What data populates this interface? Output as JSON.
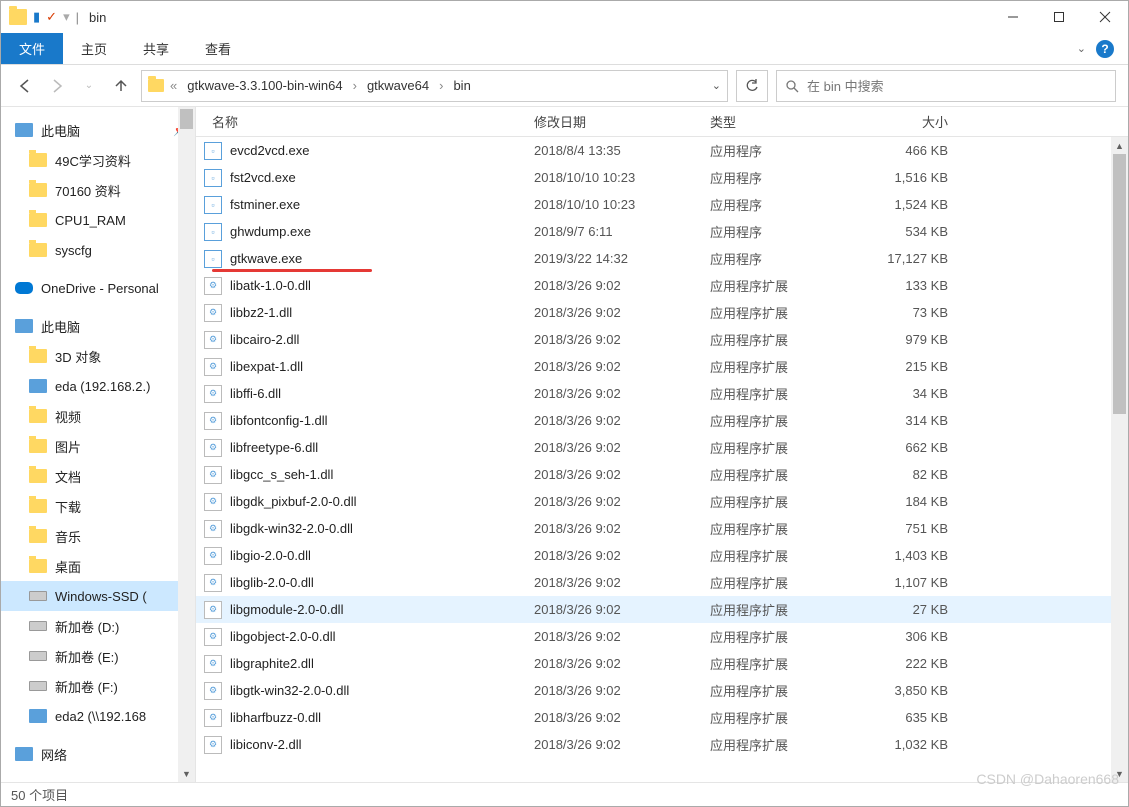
{
  "window": {
    "title": "bin",
    "separator": "|"
  },
  "ribbon": {
    "file": "文件",
    "tabs": [
      "主页",
      "共享",
      "查看"
    ]
  },
  "nav": {
    "back": "←",
    "forward": "→",
    "up": "↑"
  },
  "breadcrumbs": [
    "gtkwave-3.3.100-bin-win64",
    "gtkwave64",
    "bin"
  ],
  "search": {
    "placeholder": "在 bin 中搜索"
  },
  "navpane": {
    "quick": [
      {
        "label": "此电脑",
        "icon": "computer",
        "pin": true
      },
      {
        "label": "49C学习资料",
        "icon": "folder"
      },
      {
        "label": "70160 资料",
        "icon": "folder"
      },
      {
        "label": "CPU1_RAM",
        "icon": "folder"
      },
      {
        "label": "syscfg",
        "icon": "folder"
      }
    ],
    "onedrive": {
      "label": "OneDrive - Personal",
      "icon": "cloud"
    },
    "thispc": {
      "label": "此电脑",
      "icon": "computer"
    },
    "thispc_items": [
      {
        "label": "3D 对象",
        "icon": "folder"
      },
      {
        "label": "eda (192.168.2.)",
        "icon": "net"
      },
      {
        "label": "视频",
        "icon": "folder"
      },
      {
        "label": "图片",
        "icon": "folder"
      },
      {
        "label": "文档",
        "icon": "folder"
      },
      {
        "label": "下载",
        "icon": "folder"
      },
      {
        "label": "音乐",
        "icon": "folder"
      },
      {
        "label": "桌面",
        "icon": "folder"
      },
      {
        "label": "Windows-SSD (",
        "icon": "disk",
        "selected": true
      },
      {
        "label": "新加卷 (D:)",
        "icon": "disk"
      },
      {
        "label": "新加卷 (E:)",
        "icon": "disk"
      },
      {
        "label": "新加卷 (F:)",
        "icon": "disk"
      },
      {
        "label": "eda2 (\\\\192.168",
        "icon": "net"
      }
    ],
    "network": {
      "label": "网络",
      "icon": "net"
    }
  },
  "columns": {
    "name": "名称",
    "date": "修改日期",
    "type": "类型",
    "size": "大小"
  },
  "files": [
    {
      "name": "evcd2vcd.exe",
      "date": "2018/8/4 13:35",
      "type": "应用程序",
      "size": "466 KB",
      "icon": "exe"
    },
    {
      "name": "fst2vcd.exe",
      "date": "2018/10/10 10:23",
      "type": "应用程序",
      "size": "1,516 KB",
      "icon": "exe"
    },
    {
      "name": "fstminer.exe",
      "date": "2018/10/10 10:23",
      "type": "应用程序",
      "size": "1,524 KB",
      "icon": "exe"
    },
    {
      "name": "ghwdump.exe",
      "date": "2018/9/7 6:11",
      "type": "应用程序",
      "size": "534 KB",
      "icon": "exe"
    },
    {
      "name": "gtkwave.exe",
      "date": "2019/3/22 14:32",
      "type": "应用程序",
      "size": "17,127 KB",
      "icon": "exe",
      "underline": true
    },
    {
      "name": "libatk-1.0-0.dll",
      "date": "2018/3/26 9:02",
      "type": "应用程序扩展",
      "size": "133 KB",
      "icon": "dll"
    },
    {
      "name": "libbz2-1.dll",
      "date": "2018/3/26 9:02",
      "type": "应用程序扩展",
      "size": "73 KB",
      "icon": "dll"
    },
    {
      "name": "libcairo-2.dll",
      "date": "2018/3/26 9:02",
      "type": "应用程序扩展",
      "size": "979 KB",
      "icon": "dll"
    },
    {
      "name": "libexpat-1.dll",
      "date": "2018/3/26 9:02",
      "type": "应用程序扩展",
      "size": "215 KB",
      "icon": "dll"
    },
    {
      "name": "libffi-6.dll",
      "date": "2018/3/26 9:02",
      "type": "应用程序扩展",
      "size": "34 KB",
      "icon": "dll"
    },
    {
      "name": "libfontconfig-1.dll",
      "date": "2018/3/26 9:02",
      "type": "应用程序扩展",
      "size": "314 KB",
      "icon": "dll"
    },
    {
      "name": "libfreetype-6.dll",
      "date": "2018/3/26 9:02",
      "type": "应用程序扩展",
      "size": "662 KB",
      "icon": "dll"
    },
    {
      "name": "libgcc_s_seh-1.dll",
      "date": "2018/3/26 9:02",
      "type": "应用程序扩展",
      "size": "82 KB",
      "icon": "dll"
    },
    {
      "name": "libgdk_pixbuf-2.0-0.dll",
      "date": "2018/3/26 9:02",
      "type": "应用程序扩展",
      "size": "184 KB",
      "icon": "dll"
    },
    {
      "name": "libgdk-win32-2.0-0.dll",
      "date": "2018/3/26 9:02",
      "type": "应用程序扩展",
      "size": "751 KB",
      "icon": "dll"
    },
    {
      "name": "libgio-2.0-0.dll",
      "date": "2018/3/26 9:02",
      "type": "应用程序扩展",
      "size": "1,403 KB",
      "icon": "dll"
    },
    {
      "name": "libglib-2.0-0.dll",
      "date": "2018/3/26 9:02",
      "type": "应用程序扩展",
      "size": "1,107 KB",
      "icon": "dll"
    },
    {
      "name": "libgmodule-2.0-0.dll",
      "date": "2018/3/26 9:02",
      "type": "应用程序扩展",
      "size": "27 KB",
      "icon": "dll",
      "highlighted": true
    },
    {
      "name": "libgobject-2.0-0.dll",
      "date": "2018/3/26 9:02",
      "type": "应用程序扩展",
      "size": "306 KB",
      "icon": "dll"
    },
    {
      "name": "libgraphite2.dll",
      "date": "2018/3/26 9:02",
      "type": "应用程序扩展",
      "size": "222 KB",
      "icon": "dll"
    },
    {
      "name": "libgtk-win32-2.0-0.dll",
      "date": "2018/3/26 9:02",
      "type": "应用程序扩展",
      "size": "3,850 KB",
      "icon": "dll"
    },
    {
      "name": "libharfbuzz-0.dll",
      "date": "2018/3/26 9:02",
      "type": "应用程序扩展",
      "size": "635 KB",
      "icon": "dll"
    },
    {
      "name": "libiconv-2.dll",
      "date": "2018/3/26 9:02",
      "type": "应用程序扩展",
      "size": "1,032 KB",
      "icon": "dll"
    }
  ],
  "status": {
    "count": "50 个项目"
  },
  "watermark": "CSDN @Dahaoren668"
}
